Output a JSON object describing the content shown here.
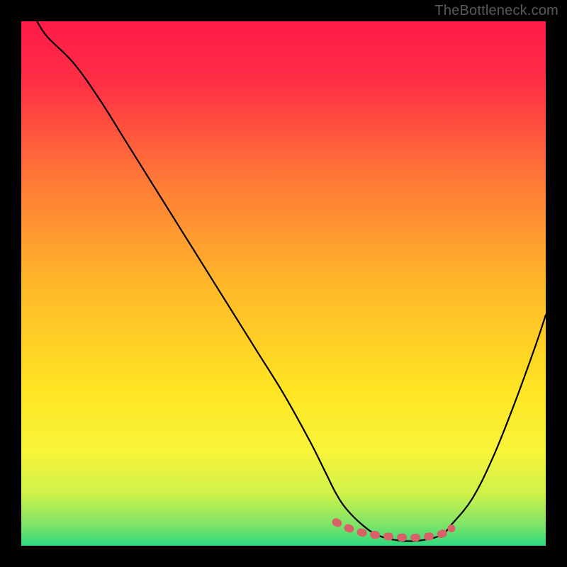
{
  "watermark": "TheBottleneck.com",
  "chart_data": {
    "type": "line",
    "title": "",
    "xlabel": "",
    "ylabel": "",
    "xlim": [
      0,
      100
    ],
    "ylim": [
      0,
      100
    ],
    "grid": false,
    "series": [
      {
        "name": "bottleneck-curve",
        "x": [
          3,
          5,
          10,
          15,
          20,
          25,
          30,
          35,
          40,
          45,
          50,
          55,
          58,
          60,
          62,
          65,
          68,
          72,
          76,
          80,
          82,
          86,
          90,
          94,
          98,
          100
        ],
        "y": [
          100,
          97,
          92,
          85,
          77,
          69,
          61,
          53,
          45,
          37,
          29,
          20,
          14,
          10,
          7,
          4,
          2,
          1,
          1,
          2,
          4,
          9,
          17,
          27,
          38,
          44
        ]
      }
    ],
    "highlight_segment": {
      "name": "optimal-zone",
      "x": [
        60,
        62,
        65,
        68,
        72,
        76,
        80,
        82
      ],
      "y": [
        4.5,
        3.5,
        2.5,
        2,
        1.6,
        1.6,
        2.2,
        3.3
      ]
    },
    "background_gradient": {
      "stops": [
        {
          "offset": 0.0,
          "color": "#ff1a49"
        },
        {
          "offset": 0.12,
          "color": "#ff3045"
        },
        {
          "offset": 0.3,
          "color": "#ff7837"
        },
        {
          "offset": 0.5,
          "color": "#ffb72a"
        },
        {
          "offset": 0.7,
          "color": "#ffe423"
        },
        {
          "offset": 0.82,
          "color": "#f8f43a"
        },
        {
          "offset": 0.9,
          "color": "#d0f24a"
        },
        {
          "offset": 0.96,
          "color": "#7de468"
        },
        {
          "offset": 1.0,
          "color": "#2fd97e"
        }
      ]
    }
  }
}
